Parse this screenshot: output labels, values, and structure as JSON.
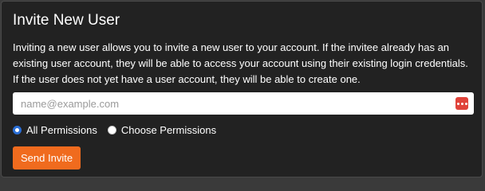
{
  "dialog": {
    "title": "Invite New User",
    "description": "Inviting a new user allows you to invite a new user to your account. If the invitee already has an existing user account, they will be able to access your account using their existing login credentials. If the user does not yet have a user account, they will be able to create one."
  },
  "email": {
    "placeholder": "name@example.com",
    "value": "",
    "autofill_icon": "password-manager-dots-icon"
  },
  "permissions": {
    "options": [
      {
        "label": "All Permissions",
        "selected": true
      },
      {
        "label": "Choose Permissions",
        "selected": false
      }
    ]
  },
  "actions": {
    "send_label": "Send Invite"
  },
  "colors": {
    "accent": "#f06b1e",
    "panel_bg": "#222222",
    "radio_selected": "#2b6fd6",
    "autofill_icon": "#e0433a"
  }
}
